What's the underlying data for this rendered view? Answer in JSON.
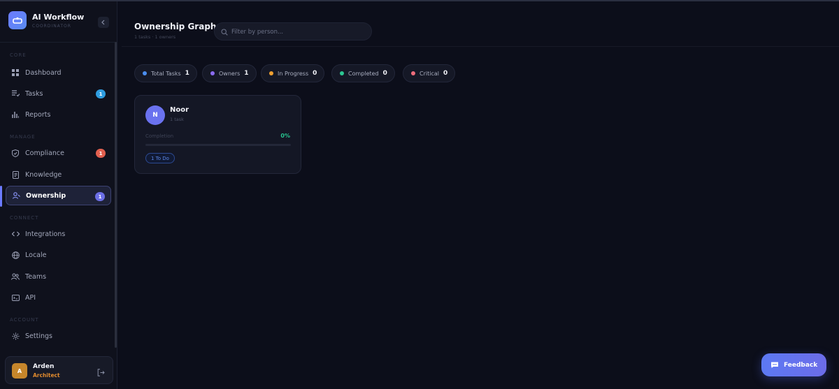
{
  "app": {
    "title": "AI Workflow",
    "subtitle": "COORDINATOR"
  },
  "sidebar": {
    "sections": [
      {
        "label": "CORE"
      },
      {
        "label": "MANAGE"
      },
      {
        "label": "CONNECT"
      },
      {
        "label": "ACCOUNT"
      }
    ],
    "items": [
      {
        "label": "Dashboard",
        "icon": "dashboard-icon"
      },
      {
        "label": "Tasks",
        "icon": "tasks-icon",
        "badge": "1",
        "badge_color": "#2f9de0"
      },
      {
        "label": "Reports",
        "icon": "bar-chart-icon"
      },
      {
        "label": "Compliance",
        "icon": "shield-check-icon",
        "badge": "1",
        "badge_color": "#e2604f"
      },
      {
        "label": "Knowledge",
        "icon": "document-icon"
      },
      {
        "label": "Ownership",
        "icon": "person-icon",
        "badge": "1",
        "badge_color": "#6c6fe6",
        "active": true
      },
      {
        "label": "Integrations",
        "icon": "code-icon"
      },
      {
        "label": "Locale",
        "icon": "globe-icon"
      },
      {
        "label": "Teams",
        "icon": "team-icon"
      },
      {
        "label": "API",
        "icon": "api-icon"
      },
      {
        "label": "Settings",
        "icon": "gear-icon"
      }
    ],
    "user": {
      "initial": "A",
      "name": "Arden",
      "role": "Architect"
    }
  },
  "header": {
    "title": "Ownership Graph",
    "subtitle": "1 tasks · 1 owners",
    "search_placeholder": "Filter by person..."
  },
  "stats": [
    {
      "label": "Total Tasks",
      "value": "1",
      "color": "#4b8ef0"
    },
    {
      "label": "Owners",
      "value": "1",
      "color": "#8b6cf0"
    },
    {
      "label": "In Progress",
      "value": "0",
      "color": "#f0a030"
    },
    {
      "label": "Completed",
      "value": "0",
      "color": "#2cc792"
    },
    {
      "label": "Critical",
      "value": "0",
      "color": "#ef6d7c"
    }
  ],
  "owners": [
    {
      "initial": "N",
      "name": "Noor",
      "tasks": "1 task",
      "completion_label": "Completion",
      "completion_value": "0%",
      "completion_fraction": 0.0,
      "status_badge": "1 To Do"
    }
  ],
  "feedback_label": "Feedback",
  "colors": {
    "accent": "#6c7bff",
    "success": "#27c28e",
    "background": "#0c0e1a"
  }
}
